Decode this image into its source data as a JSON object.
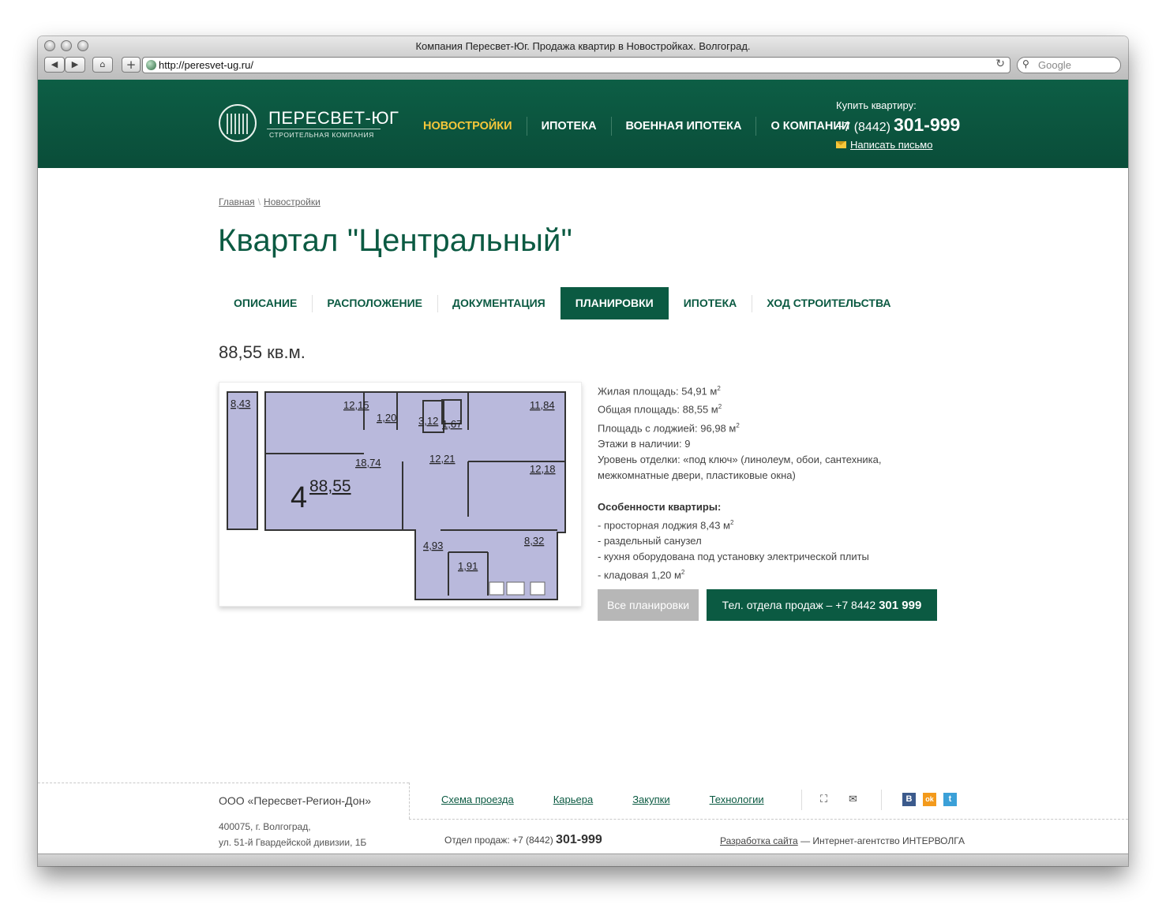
{
  "browser": {
    "window_title": "Компания Пересвет-Юг. Продажа квартир в Новостройках. Волгоград.",
    "url": "http://peresvet-ug.ru/",
    "search_placeholder": "Google"
  },
  "header": {
    "logo_name": "ПЕРЕСВЕТ-ЮГ",
    "logo_subtitle": "СТРОИТЕЛЬНАЯ КОМПАНИЯ",
    "nav": [
      "НОВОСТРОЙКИ",
      "ИПОТЕКА",
      "ВОЕННАЯ ИПОТЕКА",
      "О КОМПАНИИ"
    ],
    "buy_label": "Купить квартиру:",
    "phone_code": "+7 (8442)",
    "phone_number": "301-999",
    "write_link": "Написать письмо",
    "accent_color": "#f5c73a",
    "brand_color": "#0b5a42"
  },
  "breadcrumb": [
    "Главная",
    "Новостройки"
  ],
  "page_title": "Квартал \"Центральный\"",
  "tabs": [
    "ОПИСАНИЕ",
    "РАСПОЛОЖЕНИЕ",
    "ДОКУМЕНТАЦИЯ",
    "ПЛАНИРОВКИ",
    "ИПОТЕКА",
    "ХОД СТРОИТЕЛЬСТВА"
  ],
  "active_tab": "ПЛАНИРОВКИ",
  "area_title": "88,55 кв.м.",
  "plan": {
    "rooms_count": "4",
    "total": "88,55",
    "room_labels": [
      "8,43",
      "12,15",
      "1,20",
      "3,12",
      "1,67",
      "11,84",
      "18,74",
      "12,21",
      "12,18",
      "4,93",
      "8,32",
      "1,91"
    ]
  },
  "specs": {
    "living_label": "Жилая площадь: 54,91 м",
    "total_label": "Общая площадь: 88,55 м",
    "loggia_label": "Площадь с лоджией: 96,98 м",
    "floors_label": "Этажи в наличии: 9",
    "finish_label": "Уровень отделки: «под ключ» (линолеум, обои, сантехника, межкомнатные двери, пластиковые окна)",
    "squared": "2",
    "features_title": "Особенности квартиры:",
    "feature_1": "- просторная лоджия 8,43 м",
    "feature_2": "- раздельный санузел",
    "feature_3": "- кухня оборудована под установку электрической плиты",
    "feature_4": "- кладовая 1,20 м"
  },
  "buttons": {
    "all_plans": "Все планировки",
    "sales_phone_prefix": "Тел. отдела продаж – +7 8442",
    "sales_phone_number": "301 999"
  },
  "footer": {
    "company": "ООО «Пересвет-Регион-Дон»",
    "address_line1": "400075, г. Волгоград,",
    "address_line2": "ул. 51-й Гвардейской дивизии, 1Б",
    "links": [
      "Схема проезда",
      "Карьера",
      "Закупки",
      "Технологии"
    ],
    "sales_label": "Отдел продаж: +7 (8442)",
    "sales_number": "301-999",
    "dev_link": "Разработка сайта",
    "dev_text": "— Интернет-агентство ИНТЕРВОЛГА",
    "social": [
      "В",
      "ok",
      "t"
    ]
  }
}
